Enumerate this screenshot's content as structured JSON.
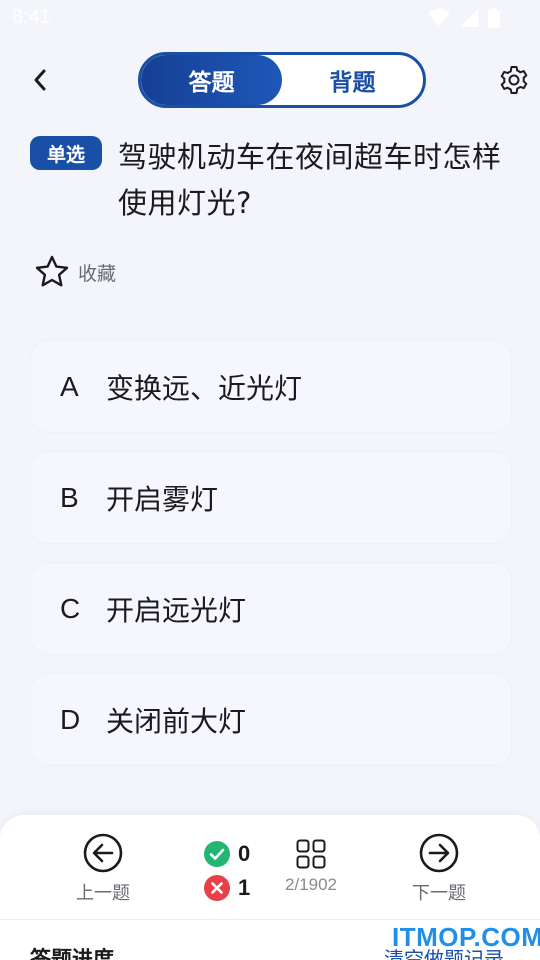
{
  "status_bar": {
    "time": "8:41",
    "icons": [
      "wifi-icon",
      "signal-icon",
      "battery-icon"
    ]
  },
  "header": {
    "back_icon": "chevron-left-icon",
    "tabs": [
      {
        "label": "答题",
        "active": true
      },
      {
        "label": "背题",
        "active": false
      }
    ],
    "settings_icon": "gear-icon"
  },
  "question": {
    "type_badge": "单选",
    "text": "驾驶机动车在夜间超车时怎样使用灯光?",
    "favorite_label": "收藏"
  },
  "options": [
    {
      "letter": "A",
      "text": "变换远、近光灯"
    },
    {
      "letter": "B",
      "text": "开启雾灯"
    },
    {
      "letter": "C",
      "text": "开启远光灯"
    },
    {
      "letter": "D",
      "text": "关闭前大灯"
    }
  ],
  "bottom_bar": {
    "prev_label": "上一题",
    "next_label": "下一题",
    "correct_count": "0",
    "wrong_count": "1",
    "progress": "2/1902",
    "progress_title": "答题进度",
    "clear_label": "清空做题记录"
  },
  "watermark": "ITMOP.COM",
  "colors": {
    "primary": "#1a4fa7",
    "correct": "#22b573",
    "wrong": "#e8404a",
    "background": "#f3f5fb"
  }
}
